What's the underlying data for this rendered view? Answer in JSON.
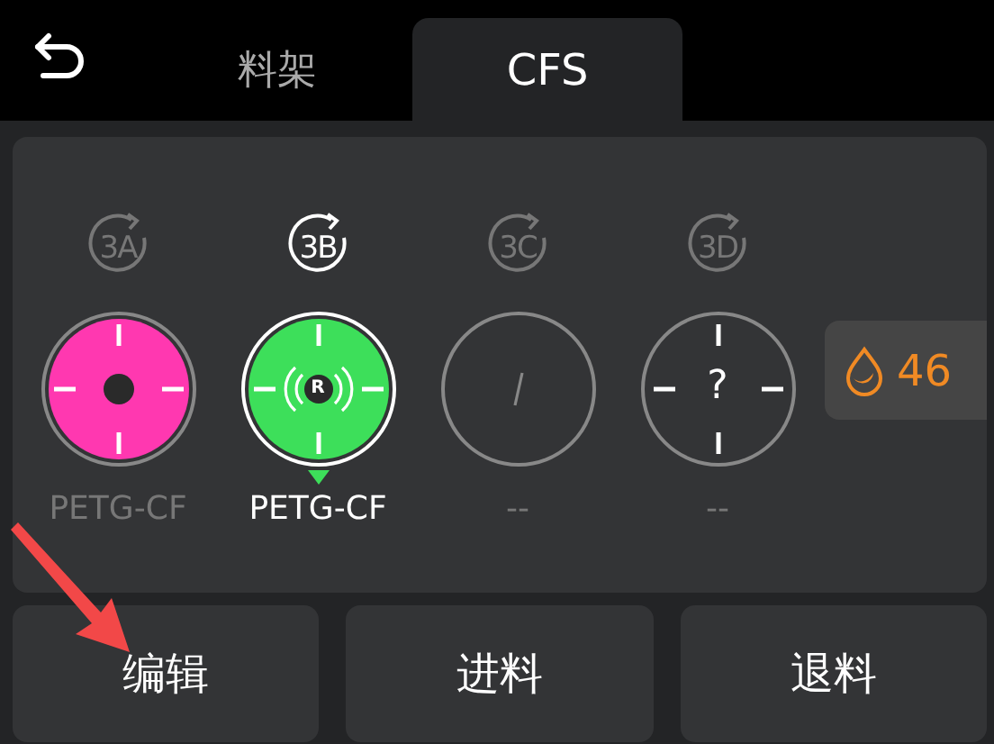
{
  "header": {
    "tabs": [
      {
        "label": "料架",
        "selected": false
      },
      {
        "label": "CFS",
        "selected": true
      }
    ]
  },
  "slots": [
    {
      "label": "3A",
      "name": "PETG-CF",
      "kind": "plain",
      "color": "#ff38b0",
      "selected": false
    },
    {
      "label": "3B",
      "name": "PETG-CF",
      "kind": "rfid",
      "color": "#3ddf5a",
      "badge": "R",
      "selected": true
    },
    {
      "label": "3C",
      "name": "--",
      "kind": "empty",
      "selected": false
    },
    {
      "label": "3D",
      "name": "--",
      "kind": "unknown",
      "mark": "?",
      "selected": false
    }
  ],
  "humidity": {
    "value": "46"
  },
  "buttons": [
    "编辑",
    "进料",
    "退料"
  ],
  "annotation": {
    "kind": "arrow"
  }
}
